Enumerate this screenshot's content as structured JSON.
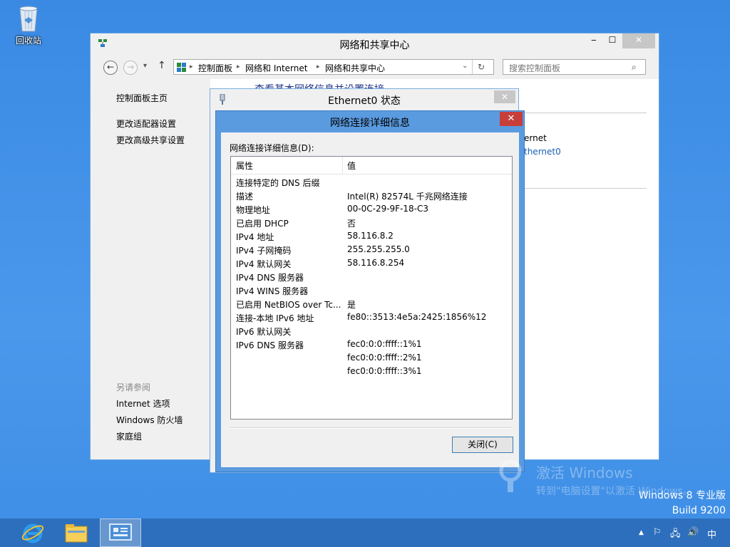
{
  "desktop": {
    "recycle_bin_label": "回收站"
  },
  "main_window": {
    "title": "网络和共享中心",
    "address": {
      "segments": [
        "控制面板",
        "网络和 Internet",
        "网络和共享中心"
      ]
    },
    "search_placeholder": "搜索控制面板",
    "left_nav": {
      "home": "控制面板主页",
      "change_adapter": "更改适配器设置",
      "change_sharing": "更改高级共享设置",
      "see_also": "另请参阅",
      "internet_options": "Internet 选项",
      "firewall": "Windows 防火墙",
      "homegroup": "家庭组"
    },
    "partial_heading": "查看基本网络信息并设置连接",
    "partial_texts": [
      "ernet",
      "thernet0"
    ]
  },
  "eth_dialog": {
    "title": "Ethernet0 状态"
  },
  "details_dialog": {
    "title": "网络连接详细信息",
    "caption": "网络连接详细信息(D):",
    "col_property": "属性",
    "col_value": "值",
    "rows": [
      {
        "p": "连接特定的 DNS 后缀",
        "v": ""
      },
      {
        "p": "描述",
        "v": "Intel(R) 82574L 千兆网络连接"
      },
      {
        "p": "物理地址",
        "v": "00-0C-29-9F-18-C3"
      },
      {
        "p": "已启用 DHCP",
        "v": "否"
      },
      {
        "p": "IPv4 地址",
        "v": "58.116.8.2"
      },
      {
        "p": "IPv4 子网掩码",
        "v": "255.255.255.0"
      },
      {
        "p": "IPv4 默认网关",
        "v": "58.116.8.254"
      },
      {
        "p": "IPv4 DNS 服务器",
        "v": ""
      },
      {
        "p": "IPv4 WINS 服务器",
        "v": ""
      },
      {
        "p": "已启用 NetBIOS over Tc...",
        "v": "是"
      },
      {
        "p": "连接-本地 IPv6 地址",
        "v": "fe80::3513:4e5a:2425:1856%12"
      },
      {
        "p": "IPv6 默认网关",
        "v": ""
      },
      {
        "p": "IPv6 DNS 服务器",
        "v": "fec0:0:0:ffff::1%1"
      },
      {
        "p": "",
        "v": "fec0:0:0:ffff::2%1"
      },
      {
        "p": "",
        "v": "fec0:0:0:ffff::3%1"
      }
    ],
    "close_button": "关闭(C)"
  },
  "watermark": {
    "line1": "激活 Windows",
    "line2": "转到\"电脑设置\"以激活 Windows。"
  },
  "build_info": {
    "edition": "Windows 8 专业版",
    "build": "Build 9200"
  },
  "taskbar": {
    "ime": "中"
  },
  "colors": {
    "desktop": "#3d8ee6",
    "taskbar": "#2d6fbd",
    "dialog_frame": "#5a9be0",
    "close_red": "#c73e3a"
  }
}
